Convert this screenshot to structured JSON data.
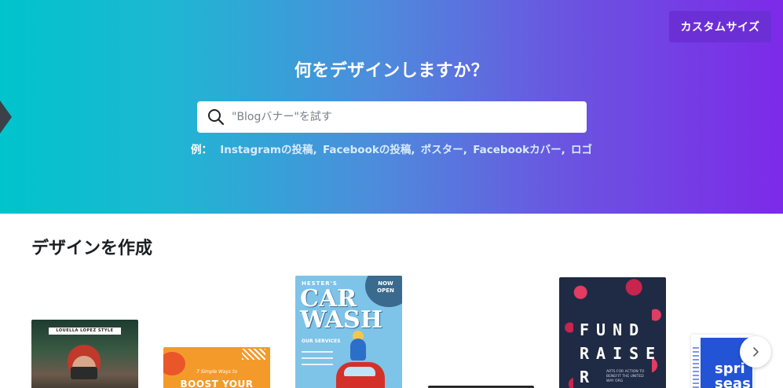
{
  "hero": {
    "custom_size_label": "カスタムサイズ",
    "title": "何をデザインしますか？",
    "search": {
      "placeholder": "\"Blogバナー\"を試す"
    },
    "examples": {
      "label": "例：",
      "links": [
        "Instagramの投稿",
        "Facebookの投稿",
        "ポスター",
        "Facebookカバー",
        "ロゴ"
      ]
    }
  },
  "section": {
    "title": "デザインを作成"
  },
  "templates": {
    "photo": {
      "banner": "LOUELLA LOPEZ STYLE"
    },
    "orange": {
      "small": "7 Simple Ways to",
      "big": "BOOST YOUR"
    },
    "carwash": {
      "top": "HESTER'S",
      "badge": "NOW OPEN",
      "title_line1": "CAR",
      "title_line2": "WASH",
      "services": "OUR SERVICES"
    },
    "fundraiser": {
      "line1": "FUND",
      "line2": "RAISE",
      "line3": "R",
      "small": "ARTS FOR ACTION TO BENEFIT THE UNITED WAY ORG"
    },
    "spring": {
      "line1": "spri",
      "line2": "seas"
    }
  },
  "icons": {
    "search": "search-icon",
    "next": "chevron-right-icon",
    "hero_arrow": "triangle-right-icon"
  },
  "colors": {
    "gradient_start": "#00c4cc",
    "gradient_end": "#7d2ae8",
    "custom_button": "#6c2fd6"
  }
}
